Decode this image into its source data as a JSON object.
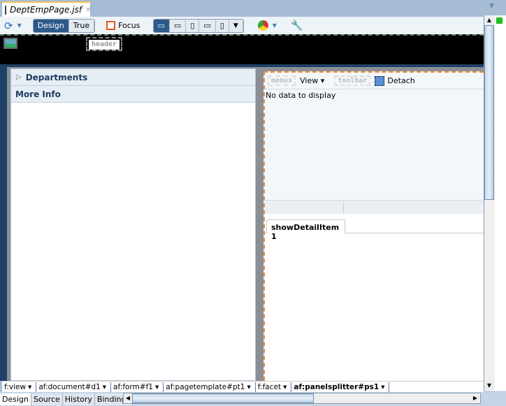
{
  "editor_tab": {
    "title": "DeptEmpPage.jsf",
    "close": "✕"
  },
  "toolbar": {
    "design": "Design",
    "true": "True",
    "focus": "Focus"
  },
  "header_facet": "header",
  "left_panel": {
    "items": [
      {
        "label": "Departments",
        "icon": "chevron-right-icon"
      },
      {
        "label": "More Info"
      }
    ]
  },
  "right_panel": {
    "menus": "menus",
    "view": "View",
    "toolbar": "toolbar",
    "detach": "Detach",
    "empty": "No data to display",
    "tab": "showDetailItem 1"
  },
  "breadcrumbs": [
    "f:view",
    "af:document#d1",
    "af:form#f1",
    "af:pagetemplate#pt1",
    "f:facet",
    "af:panelsplitter#ps1"
  ],
  "bottom_tabs": [
    "Design",
    "Source",
    "History",
    "Bindings"
  ],
  "colors": {
    "accent": "#2c5a8a",
    "selection": "#f08a30",
    "status": "#22bb22"
  }
}
